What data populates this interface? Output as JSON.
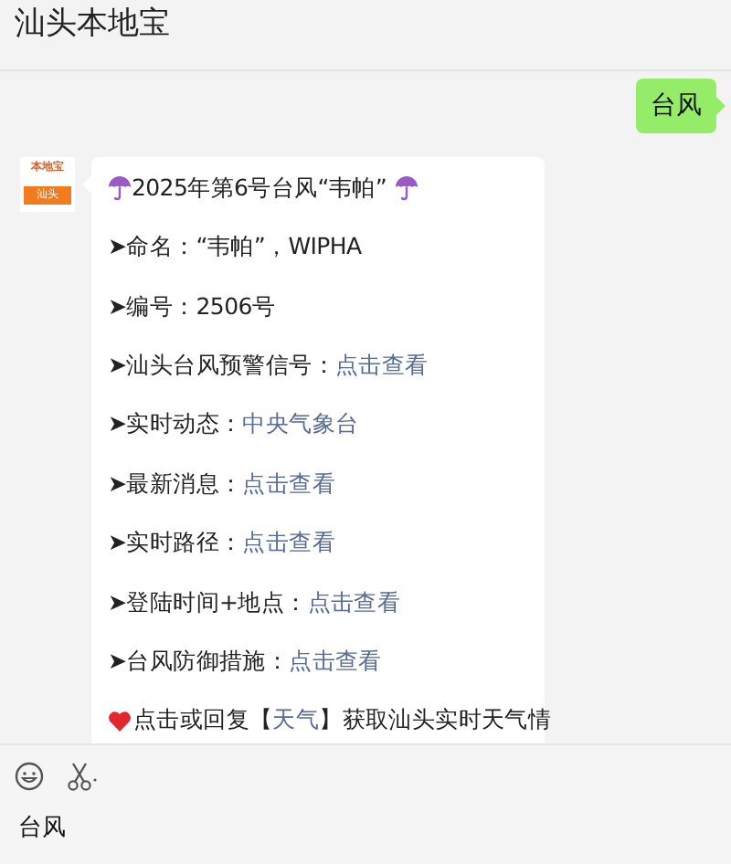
{
  "header": {
    "title": "汕头本地宝"
  },
  "messages": [
    {
      "kind": "sent",
      "text": "台风"
    },
    {
      "kind": "received",
      "avatar": {
        "top": "本地宝",
        "bottom": "汕头"
      },
      "lines": [
        {
          "kind": "title",
          "segments": [
            {
              "text": "2025年第6号台风“韦帕”",
              "link": false
            }
          ]
        },
        {
          "kind": "item",
          "segments": [
            {
              "text": "➤命名：“韦帕”，WIPHA",
              "link": false
            }
          ]
        },
        {
          "kind": "item",
          "segments": [
            {
              "text": "➤编号：2506号",
              "link": false
            }
          ]
        },
        {
          "kind": "item",
          "segments": [
            {
              "text": "➤汕头台风预警信号：",
              "link": false
            },
            {
              "text": "点击查看",
              "link": true
            }
          ]
        },
        {
          "kind": "item",
          "segments": [
            {
              "text": "➤实时动态：",
              "link": false
            },
            {
              "text": "中央气象台",
              "link": true
            }
          ]
        },
        {
          "kind": "item",
          "segments": [
            {
              "text": "➤最新消息：",
              "link": false
            },
            {
              "text": "点击查看",
              "link": true
            }
          ]
        },
        {
          "kind": "item",
          "segments": [
            {
              "text": "➤实时路径：",
              "link": false
            },
            {
              "text": "点击查看",
              "link": true
            }
          ]
        },
        {
          "kind": "item",
          "segments": [
            {
              "text": "➤登陆时间+地点：",
              "link": false
            },
            {
              "text": "点击查看",
              "link": true
            }
          ]
        },
        {
          "kind": "item",
          "segments": [
            {
              "text": "➤台风防御措施：",
              "link": false
            },
            {
              "text": "点击查看",
              "link": true
            }
          ]
        },
        {
          "kind": "note",
          "segments": [
            {
              "text": "点击或回复【",
              "link": false
            },
            {
              "text": "天气",
              "link": true
            },
            {
              "text": "】获取汕头实时天气情",
              "link": false
            }
          ]
        }
      ]
    }
  ],
  "input": {
    "value": "台风"
  }
}
